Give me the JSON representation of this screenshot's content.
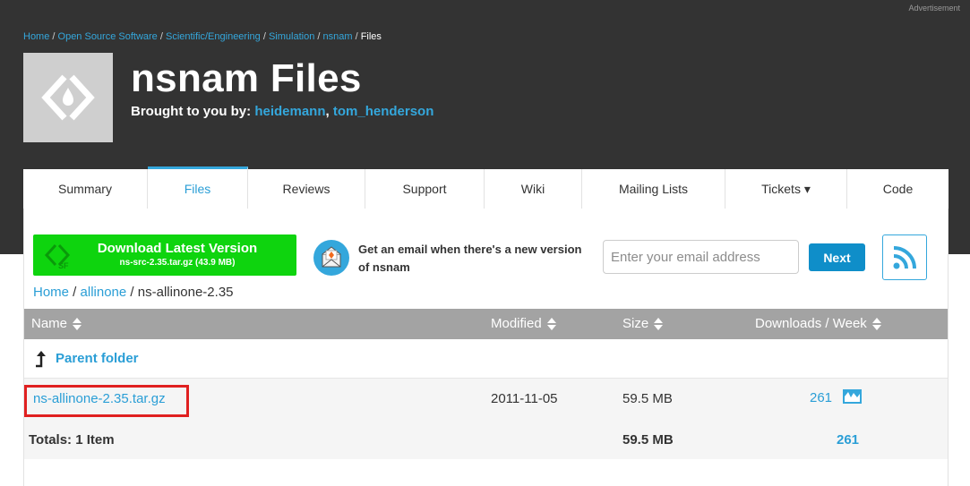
{
  "header": {
    "ad_label": "Advertisement",
    "breadcrumb": [
      {
        "label": "Home"
      },
      {
        "label": "Open Source Software"
      },
      {
        "label": "Scientific/Engineering"
      },
      {
        "label": "Simulation"
      },
      {
        "label": "nsnam"
      }
    ],
    "breadcrumb_current": "Files",
    "title": "nsnam Files",
    "brought_prefix": "Brought to you by:",
    "authors": [
      "heidemann",
      "tom_henderson"
    ]
  },
  "tabs": [
    {
      "label": "Summary",
      "active": false
    },
    {
      "label": "Files",
      "active": true
    },
    {
      "label": "Reviews",
      "active": false
    },
    {
      "label": "Support",
      "active": false
    },
    {
      "label": "Wiki",
      "active": false
    },
    {
      "label": "Mailing Lists",
      "active": false
    },
    {
      "label": "Tickets ▾",
      "active": false
    },
    {
      "label": "Code",
      "active": false
    }
  ],
  "download": {
    "label": "Download Latest Version",
    "file": "ns-src-2.35.tar.gz (43.9 MB)"
  },
  "email": {
    "prompt": "Get an email when there's a new version of nsnam",
    "placeholder": "Enter your email address",
    "next_label": "Next"
  },
  "path": {
    "home": "Home",
    "folder": "allinone",
    "current": "ns-allinone-2.35"
  },
  "table": {
    "headers": {
      "name": "Name",
      "modified": "Modified",
      "size": "Size",
      "downloads": "Downloads / Week"
    },
    "parent_label": "Parent folder",
    "rows": [
      {
        "name": "ns-allinone-2.35.tar.gz",
        "modified": "2011-11-05",
        "size": "59.5 MB",
        "downloads": "261"
      }
    ],
    "totals": {
      "label": "Totals: 1 Item",
      "size": "59.5 MB",
      "downloads": "261"
    }
  },
  "colors": {
    "header_bg": "#333333",
    "accent": "#34a7dc",
    "download_green": "#0ed40e",
    "table_head": "#a3a3a3",
    "highlight": "#e02020"
  }
}
